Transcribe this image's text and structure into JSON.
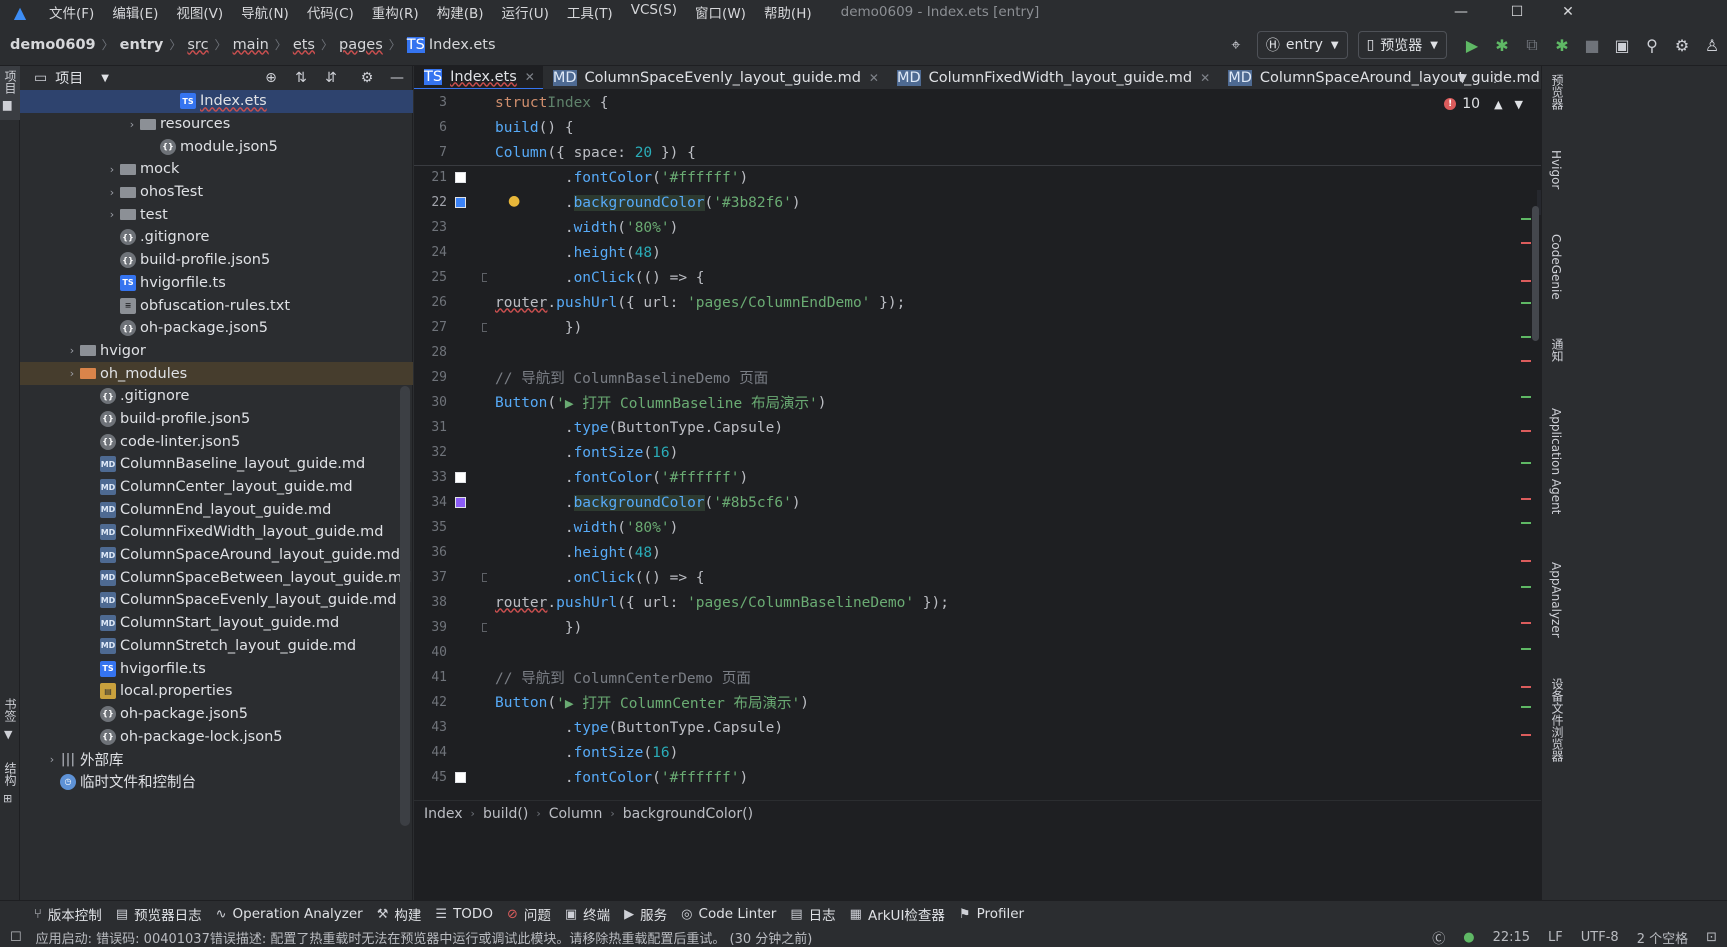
{
  "app": {
    "window_title": "demo0609 - Index.ets [entry]"
  },
  "menu": [
    "文件(F)",
    "编辑(E)",
    "视图(V)",
    "导航(N)",
    "代码(C)",
    "重构(R)",
    "构建(B)",
    "运行(U)",
    "工具(T)",
    "VCS(S)",
    "窗口(W)",
    "帮助(H)"
  ],
  "breadcrumb": [
    "demo0609",
    "entry",
    "src",
    "main",
    "ets",
    "pages",
    "Index.ets"
  ],
  "toolbar": {
    "module": "entry",
    "device": "预览器"
  },
  "project": {
    "title": "项目",
    "rows": [
      {
        "label": "Index.ets",
        "icon": "ts",
        "indent": 7
      },
      {
        "label": "resources",
        "icon": "folder",
        "indent": 5,
        "arrow": "›"
      },
      {
        "label": "module.json5",
        "icon": "json",
        "indent": 6
      },
      {
        "label": "mock",
        "icon": "folder",
        "indent": 4,
        "arrow": "›"
      },
      {
        "label": "ohosTest",
        "icon": "folder",
        "indent": 4,
        "arrow": "›"
      },
      {
        "label": "test",
        "icon": "folder",
        "indent": 4,
        "arrow": "›"
      },
      {
        "label": ".gitignore",
        "icon": "json",
        "indent": 4
      },
      {
        "label": "build-profile.json5",
        "icon": "json",
        "indent": 4
      },
      {
        "label": "hvigorfile.ts",
        "icon": "ts",
        "indent": 4
      },
      {
        "label": "obfuscation-rules.txt",
        "icon": "txt",
        "indent": 4
      },
      {
        "label": "oh-package.json5",
        "icon": "json",
        "indent": 4
      },
      {
        "label": "hvigor",
        "icon": "folder",
        "indent": 2,
        "arrow": "›"
      },
      {
        "label": "oh_modules",
        "icon": "ofolder",
        "indent": 2,
        "arrow": "›"
      },
      {
        "label": ".gitignore",
        "icon": "json",
        "indent": 3
      },
      {
        "label": "build-profile.json5",
        "icon": "json",
        "indent": 3
      },
      {
        "label": "code-linter.json5",
        "icon": "json",
        "indent": 3
      },
      {
        "label": "ColumnBaseline_layout_guide.md",
        "icon": "md",
        "indent": 3
      },
      {
        "label": "ColumnCenter_layout_guide.md",
        "icon": "md",
        "indent": 3
      },
      {
        "label": "ColumnEnd_layout_guide.md",
        "icon": "md",
        "indent": 3
      },
      {
        "label": "ColumnFixedWidth_layout_guide.md",
        "icon": "md",
        "indent": 3
      },
      {
        "label": "ColumnSpaceAround_layout_guide.md",
        "icon": "md",
        "indent": 3
      },
      {
        "label": "ColumnSpaceBetween_layout_guide.md",
        "icon": "md",
        "indent": 3
      },
      {
        "label": "ColumnSpaceEvenly_layout_guide.md",
        "icon": "md",
        "indent": 3
      },
      {
        "label": "ColumnStart_layout_guide.md",
        "icon": "md",
        "indent": 3
      },
      {
        "label": "ColumnStretch_layout_guide.md",
        "icon": "md",
        "indent": 3
      },
      {
        "label": "hvigorfile.ts",
        "icon": "ts",
        "indent": 3
      },
      {
        "label": "local.properties",
        "icon": "prop",
        "indent": 3
      },
      {
        "label": "oh-package.json5",
        "icon": "json",
        "indent": 3
      },
      {
        "label": "oh-package-lock.json5",
        "icon": "json",
        "indent": 3
      },
      {
        "label": "外部库",
        "icon": "lib",
        "indent": 1,
        "arrow": "›"
      },
      {
        "label": "临时文件和控制台",
        "icon": "tmp",
        "indent": 1
      }
    ]
  },
  "left_strip": {
    "top": "项目",
    "mid": "书签",
    "bottom": "结构"
  },
  "tabs": [
    {
      "label": "Index.ets",
      "icon": "ts"
    },
    {
      "label": "ColumnSpaceEvenly_layout_guide.md",
      "icon": "md"
    },
    {
      "label": "ColumnFixedWidth_layout_guide.md",
      "icon": "md"
    },
    {
      "label": "ColumnSpaceAround_layout_guide.md",
      "icon": "md"
    }
  ],
  "editor": {
    "errors": "10",
    "lines": [
      {
        "n": "3",
        "html": "<span class=\"kw\">struct</span> <span class=\"typ\" style=\"color:#5f826b\">Index</span> {"
      },
      {
        "n": "6",
        "html": "  <span class=\"fn\">build</span>() {"
      },
      {
        "n": "7",
        "html": "    <span class=\"fn\">Column</span>({ space: <span class=\"num\">20</span> }) {"
      },
      {
        "n": "21",
        "html": "        .<span class=\"fn\">fontColor</span>(<span class=\"str\">'#ffffff'</span>)",
        "sw": "#ffffff"
      },
      {
        "n": "22",
        "html": "        .<span class=\"fn hlbg\">backgroundColor</span>(<span class=\"str\">'#3b82f6'</span>)",
        "sw": "#3b82f6",
        "cur": true,
        "bulb": true
      },
      {
        "n": "23",
        "html": "        .<span class=\"fn\">width</span>(<span class=\"str\">'80%'</span>)"
      },
      {
        "n": "24",
        "html": "        .<span class=\"fn\">height</span>(<span class=\"num\">48</span>)"
      },
      {
        "n": "25",
        "html": "        .<span class=\"fn\">onClick</span>(() => {",
        "fold": true
      },
      {
        "n": "26",
        "html": "          <span class=\"und\">router</span>.<span class=\"fn\">pushUrl</span>({ url: <span class=\"str\">'pages/ColumnEndDemo'</span> });"
      },
      {
        "n": "27",
        "html": "        })",
        "fold": true
      },
      {
        "n": "28",
        "html": ""
      },
      {
        "n": "29",
        "html": "      <span class=\"cmt\">// 导航到 ColumnBaselineDemo 页面</span>"
      },
      {
        "n": "30",
        "html": "      <span class=\"fn\">Button</span>(<span class=\"str\">'▶ 打开 ColumnBaseline 布局演示'</span>)"
      },
      {
        "n": "31",
        "html": "        .<span class=\"fn\">type</span>(ButtonType.Capsule)"
      },
      {
        "n": "32",
        "html": "        .<span class=\"fn\">fontSize</span>(<span class=\"num\">16</span>)"
      },
      {
        "n": "33",
        "html": "        .<span class=\"fn\">fontColor</span>(<span class=\"str\">'#ffffff'</span>)",
        "sw": "#ffffff"
      },
      {
        "n": "34",
        "html": "        .<span class=\"fn hlbg\">backgroundColor</span>(<span class=\"str\">'#8b5cf6'</span>)",
        "sw": "#8b5cf6"
      },
      {
        "n": "35",
        "html": "        .<span class=\"fn\">width</span>(<span class=\"str\">'80%'</span>)"
      },
      {
        "n": "36",
        "html": "        .<span class=\"fn\">height</span>(<span class=\"num\">48</span>)"
      },
      {
        "n": "37",
        "html": "        .<span class=\"fn\">onClick</span>(() => {",
        "fold": true
      },
      {
        "n": "38",
        "html": "          <span class=\"und\">router</span>.<span class=\"fn\">pushUrl</span>({ url: <span class=\"str\">'pages/ColumnBaselineDemo'</span> });"
      },
      {
        "n": "39",
        "html": "        })",
        "fold": true
      },
      {
        "n": "40",
        "html": ""
      },
      {
        "n": "41",
        "html": "      <span class=\"cmt\">// 导航到 ColumnCenterDemo 页面</span>"
      },
      {
        "n": "42",
        "html": "      <span class=\"fn\">Button</span>(<span class=\"str\">'▶ 打开 ColumnCenter 布局演示'</span>)"
      },
      {
        "n": "43",
        "html": "        .<span class=\"fn\">type</span>(ButtonType.Capsule)"
      },
      {
        "n": "44",
        "html": "        .<span class=\"fn\">fontSize</span>(<span class=\"num\">16</span>)"
      },
      {
        "n": "45",
        "html": "        .<span class=\"fn\">fontColor</span>(<span class=\"str\">'#ffffff'</span>)",
        "sw": "#ffffff"
      }
    ],
    "breadcrumb": [
      "Index",
      "build()",
      "Column",
      "backgroundColor()"
    ]
  },
  "right_strip": [
    "预览器",
    "Hvigor",
    "CodeGenie",
    "通知",
    "Application Agent",
    "AppAnalyzer",
    "设备文件浏览器"
  ],
  "bottom_tools": [
    "版本控制",
    "预览器日志",
    "Operation Analyzer",
    "构建",
    "TODO",
    "问题",
    "终端",
    "服务",
    "Code Linter",
    "日志",
    "ArkUI检查器",
    "Profiler"
  ],
  "status": {
    "message": "应用启动: 错误码: 00401037错误描述: 配置了热重载时无法在预览器中运行或调试此模块。请移除热重载配置后重试。 (30 分钟之前)",
    "position": "22:15",
    "line_sep": "LF",
    "encoding": "UTF-8",
    "indent": "2 个空格"
  }
}
